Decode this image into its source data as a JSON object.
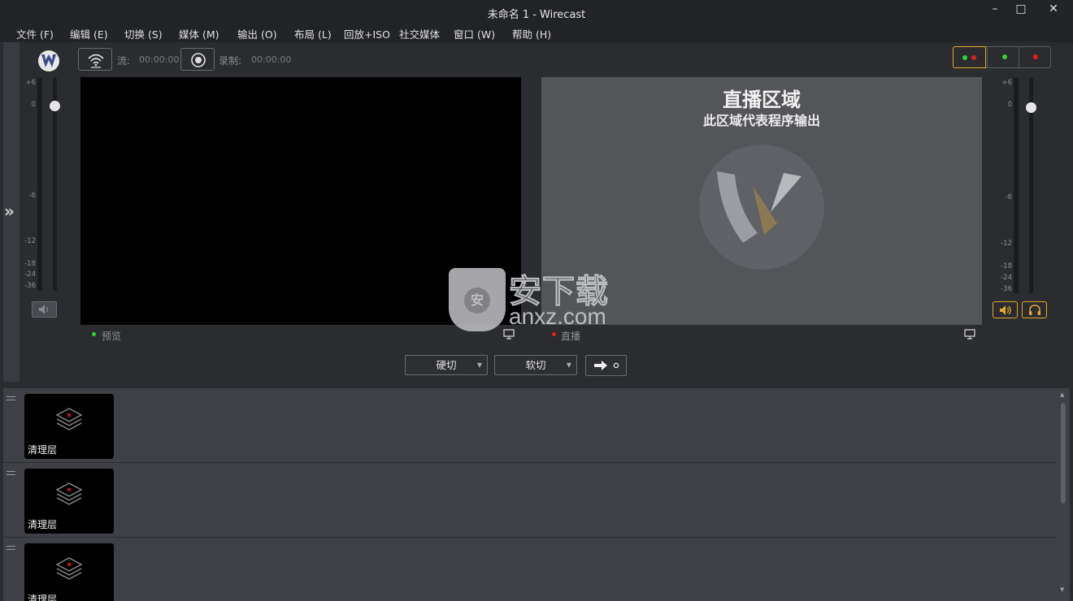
{
  "window": {
    "title": "未命名 1 - Wirecast",
    "controls": {
      "minimize": "–",
      "maximize": "□",
      "close": "✕"
    }
  },
  "menu": [
    {
      "label": "文件 (F)"
    },
    {
      "label": "编辑 (E)"
    },
    {
      "label": "切换 (S)"
    },
    {
      "label": "媒体 (M)"
    },
    {
      "label": "输出 (O)"
    },
    {
      "label": "布局 (L)"
    },
    {
      "label": "回放+ISO"
    },
    {
      "label": "社交媒体"
    },
    {
      "label": "窗口 (W)"
    },
    {
      "label": "帮助 (H)"
    }
  ],
  "toolbar": {
    "stream_label": "流:",
    "stream_time": "00:00:00",
    "record_label": "录制:",
    "record_time": "00:00:00",
    "icons": [
      "wirecast-logo-icon",
      "stream-wifi-icon",
      "record-icon"
    ]
  },
  "layout_toggle": {
    "options": [
      "preview-and-live",
      "live-only",
      "preview-only"
    ],
    "selected": "preview-and-live",
    "colors": {
      "green": "#2bd82b",
      "red": "#e02020",
      "accent": "#e0a92a"
    }
  },
  "meters": {
    "left_scale": [
      "+6",
      "0",
      "-6",
      "-12",
      "-18",
      "-24",
      "-36"
    ],
    "right_scale": [
      "+6",
      "0",
      "-6",
      "-12",
      "-18",
      "-24",
      "-36"
    ]
  },
  "preview": {
    "label": "预览",
    "status_color": "#2bd82b"
  },
  "live": {
    "label": "直播",
    "status_color": "#e02020",
    "title": "直播区域",
    "subtitle": "此区域代表程序输出"
  },
  "transitions": {
    "cut_label": "硬切",
    "smooth_label": "软切",
    "go_icon": "arrow-right-icon"
  },
  "watermark": {
    "cn": "安下载",
    "en": "anxz.com",
    "shield_glyph": "安"
  },
  "layers": [
    {
      "label": "清理层"
    },
    {
      "label": "清理层"
    },
    {
      "label": "清理层"
    }
  ]
}
